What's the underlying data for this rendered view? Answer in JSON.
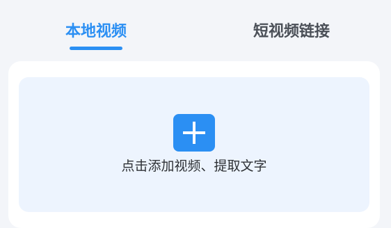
{
  "tabs": [
    {
      "label": "本地视频",
      "active": true
    },
    {
      "label": "短视频链接",
      "active": false
    }
  ],
  "upload": {
    "icon": "plus-icon",
    "hint": "点击添加视频、提取文字"
  },
  "colors": {
    "accent": "#2b8ff3",
    "background": "#f3f5f9",
    "upload_area": "#edf4fe",
    "inactive_tab": "#4a4f57"
  }
}
